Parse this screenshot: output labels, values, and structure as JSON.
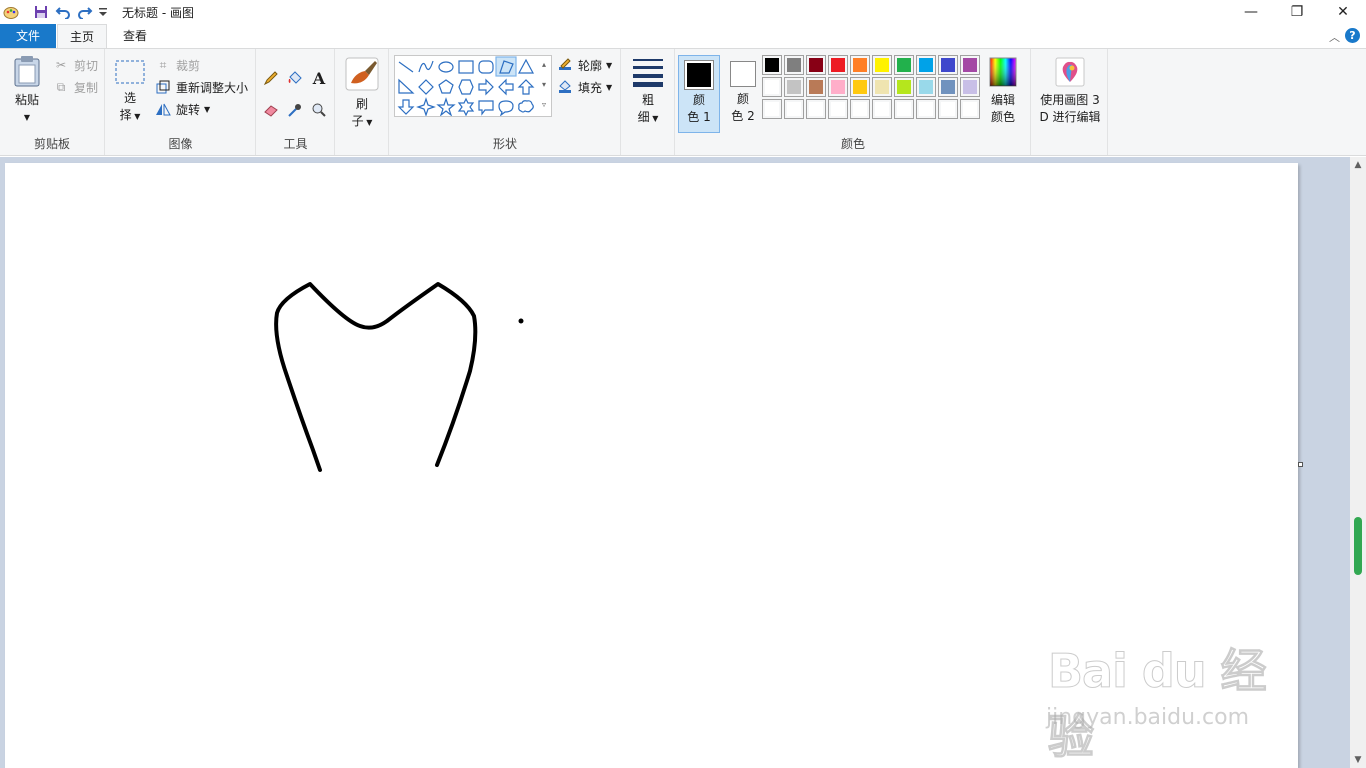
{
  "window": {
    "title": "无标题 - 画图",
    "minimize": "—",
    "maximize": "❐",
    "close": "✕"
  },
  "tabs": {
    "file": "文件",
    "home": "主页",
    "view": "查看"
  },
  "clipboard": {
    "paste": "粘贴",
    "cut": "剪切",
    "copy": "复制",
    "label": "剪贴板"
  },
  "image": {
    "select_line1": "选",
    "select_line2": "择",
    "crop": "裁剪",
    "resize": "重新调整大小",
    "rotate": "旋转",
    "label": "图像"
  },
  "tools": {
    "label": "工具",
    "text_glyph": "A"
  },
  "brushes": {
    "line1": "刷",
    "line2": "子"
  },
  "shapes": {
    "outline": "轮廓",
    "fill": "填充",
    "label": "形状"
  },
  "size": {
    "line1": "粗",
    "line2": "细"
  },
  "colors": {
    "color1_line1": "颜",
    "color1_line2": "色 1",
    "color2_line1": "颜",
    "color2_line2": "色 2",
    "edit_line1": "编辑",
    "edit_line2": "颜色",
    "label": "颜色",
    "color1_value": "#000000",
    "color2_value": "#ffffff",
    "palette_row1": [
      "#000000",
      "#7f7f7f",
      "#880015",
      "#ed1c24",
      "#ff7f27",
      "#fff200",
      "#22b14c",
      "#00a2e8",
      "#3f48cc",
      "#a349a4"
    ],
    "palette_row2": [
      "#ffffff",
      "#c3c3c3",
      "#b97a57",
      "#ffaec9",
      "#ffc90e",
      "#efe4b0",
      "#b5e61d",
      "#99d9ea",
      "#7092be",
      "#c8bfe7"
    ],
    "palette_row3": [
      "#ffffff",
      "#ffffff",
      "#ffffff",
      "#ffffff",
      "#ffffff",
      "#ffffff",
      "#ffffff",
      "#ffffff",
      "#ffffff",
      "#ffffff"
    ]
  },
  "paint3d": {
    "line1": "使用画图 3",
    "line2": "D 进行编辑"
  },
  "watermark": {
    "main": "Bai du 经验",
    "sub": "jingyan.baidu.com"
  }
}
